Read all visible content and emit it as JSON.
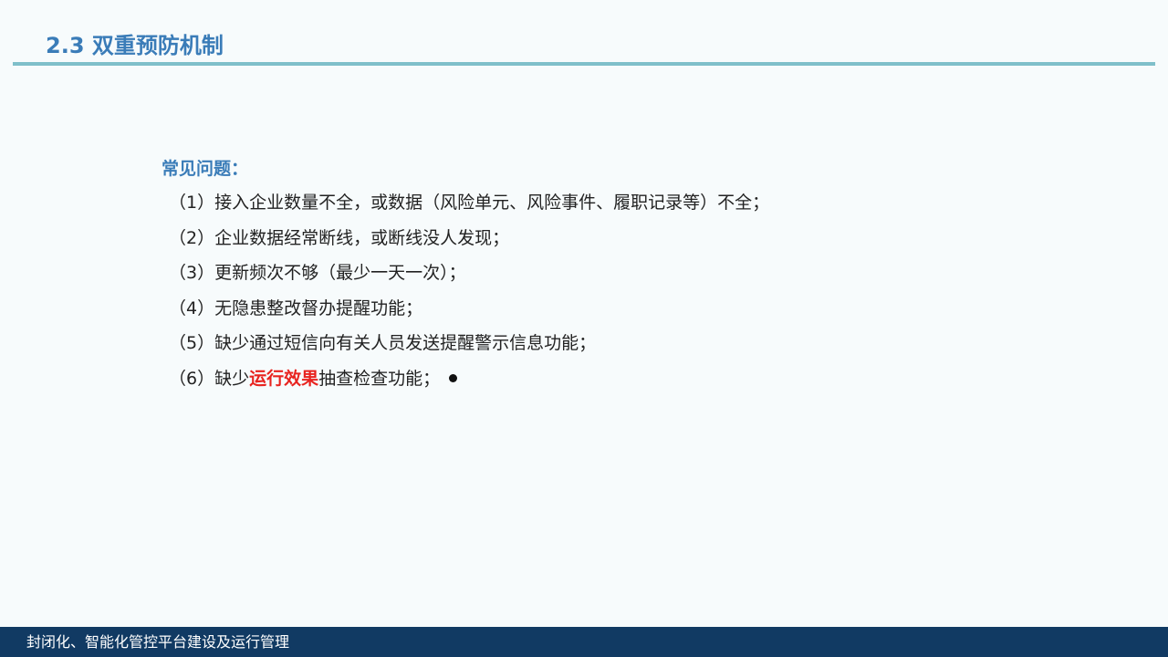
{
  "slide": {
    "title": "2.3 双重预防机制"
  },
  "content": {
    "heading": "常见问题：",
    "items": [
      {
        "text": "（1）接入企业数量不全，或数据（风险单元、风险事件、履职记录等）不全；"
      },
      {
        "text": "（2）企业数据经常断线，或断线没人发现；"
      },
      {
        "text": "（3）更新频次不够（最少一天一次）；"
      },
      {
        "text": "（4）无隐患整改督办提醒功能；"
      },
      {
        "text": "（5）缺少通过短信向有关人员发送提醒警示信息功能；"
      },
      {
        "prefix": "（6）缺少",
        "emphasis": "运行效果",
        "suffix": "抽查检查功能；"
      }
    ]
  },
  "footer": {
    "text": "封闭化、智能化管控平台建设及运行管理"
  },
  "colors": {
    "title": "#3a7cb8",
    "rule": "#7fbfca",
    "emphasis": "#e8231f",
    "footer_bg": "#113a63",
    "footer_text": "#ffffff"
  }
}
